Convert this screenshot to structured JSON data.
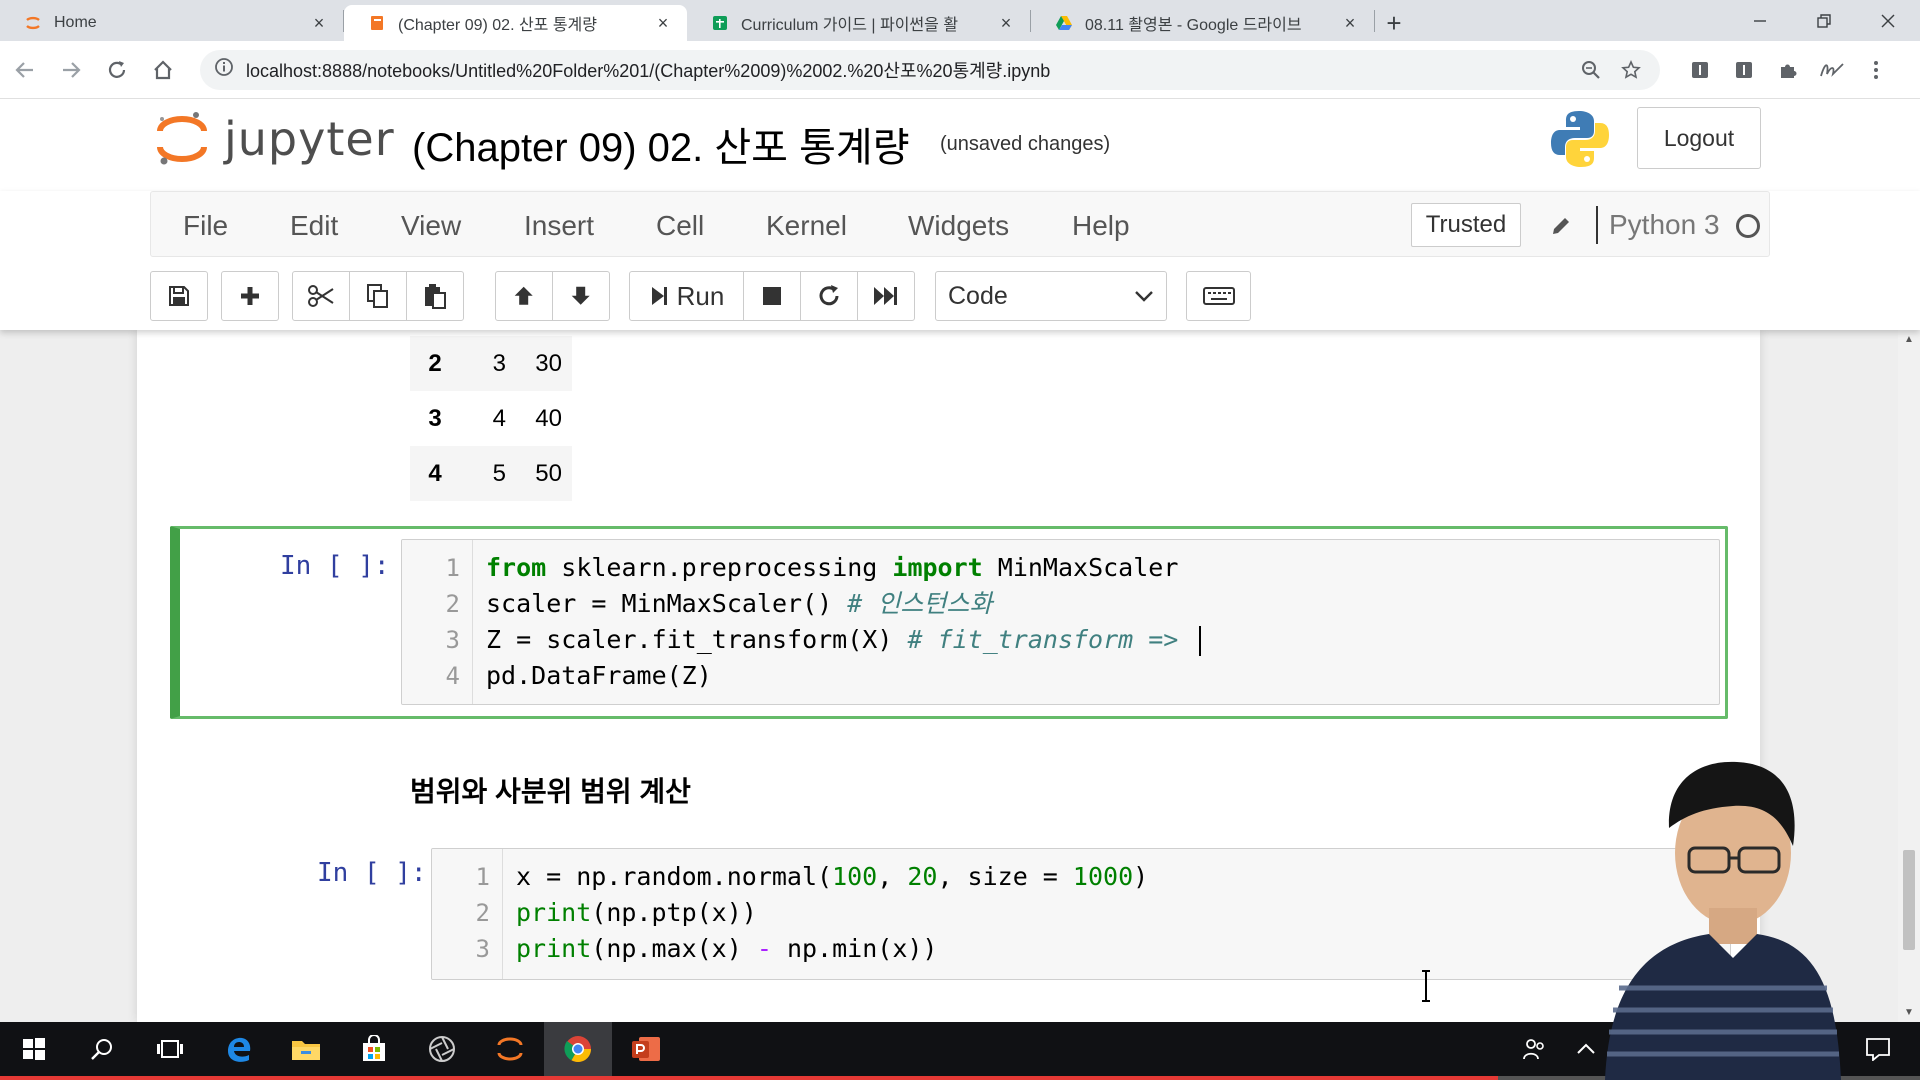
{
  "browser": {
    "tabs": [
      {
        "title": "Home",
        "icon": "jupyter-favicon",
        "active": false
      },
      {
        "title": "(Chapter 09) 02. 산포 통계량",
        "icon": "notebook-favicon",
        "active": true
      },
      {
        "title": "Curriculum 가이드 | 파이썬을 활",
        "icon": "sheets-favicon",
        "active": false
      },
      {
        "title": "08.11 촬영본 - Google 드라이브",
        "icon": "drive-favicon",
        "active": false
      }
    ],
    "tab_close": "×",
    "new_tab": "+",
    "url": "localhost:8888/notebooks/Untitled%20Folder%201/(Chapter%2009)%2002.%20산포%20통계량.ipynb"
  },
  "jupyter": {
    "logo_text": "jupyter",
    "notebook_title": "(Chapter 09) 02. 산포 통계량",
    "save_status": "(unsaved changes)",
    "logout_label": "Logout",
    "menu": [
      "File",
      "Edit",
      "View",
      "Insert",
      "Cell",
      "Kernel",
      "Widgets",
      "Help"
    ],
    "trusted_label": "Trusted",
    "kernel_name": "Python 3",
    "run_label": "Run",
    "cell_type": "Code"
  },
  "dataframe_rows": [
    {
      "index": "2",
      "col0": "3",
      "col1": "30"
    },
    {
      "index": "3",
      "col0": "4",
      "col1": "40"
    },
    {
      "index": "4",
      "col0": "5",
      "col1": "50"
    }
  ],
  "cells": [
    {
      "prompt": "In [ ]:",
      "lines": [
        "1",
        "2",
        "3",
        "4"
      ]
    },
    {
      "prompt": "In [ ]:",
      "lines": [
        "1",
        "2",
        "3"
      ]
    }
  ],
  "markdown_heading": "범위와 사분위 범위 계산",
  "colors": {
    "selected_cell_border": "#66bb6a",
    "prompt_color": "#303f9f",
    "keyword_green": "#008000",
    "comment_teal": "#408080",
    "taskbar_bg": "#101114",
    "video_progress": "#e53935"
  },
  "video_progress_fraction": 0.78
}
